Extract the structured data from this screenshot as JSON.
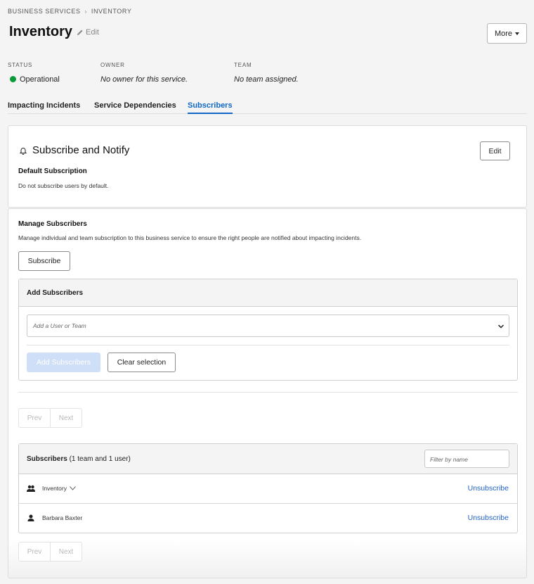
{
  "breadcrumb": [
    "BUSINESS SERVICES",
    "INVENTORY"
  ],
  "header": {
    "title": "Inventory",
    "edit_label": "Edit",
    "more_label": "More"
  },
  "meta": {
    "status": {
      "label": "STATUS",
      "value": "Operational",
      "color": "#0a9a37"
    },
    "owner": {
      "label": "OWNER",
      "value": "No owner for this service."
    },
    "team": {
      "label": "TEAM",
      "value": "No team assigned."
    }
  },
  "tabs": [
    {
      "label": "Impacting Incidents",
      "active": false
    },
    {
      "label": "Service Dependencies",
      "active": false
    },
    {
      "label": "Subscribers",
      "active": true
    }
  ],
  "notify_card": {
    "icon": "bell-icon",
    "title": "Subscribe and Notify",
    "edit_label": "Edit",
    "default_heading": "Default Subscription",
    "default_text": "Do not subscribe users by default."
  },
  "manage": {
    "heading": "Manage Subscribers",
    "description": "Manage individual and team subscription to this business service to ensure the right people are notified about impacting incidents.",
    "subscribe_label": "Subscribe",
    "add_panel": {
      "heading": "Add Subscribers",
      "select_placeholder": "Add a User or Team",
      "add_button": "Add Subscribers",
      "clear_button": "Clear selection"
    },
    "pager": {
      "prev": "Prev",
      "next": "Next"
    },
    "table": {
      "heading": "Subscribers",
      "summary": "(1 team and 1 user)",
      "filter_placeholder": "Filter by name",
      "rows": [
        {
          "type": "team",
          "icon": "team-icon",
          "name": "Inventory",
          "expandable": true,
          "action": "Unsubscribe"
        },
        {
          "type": "user",
          "icon": "user-icon",
          "name": "Barbara Baxter",
          "expandable": false,
          "action": "Unsubscribe"
        }
      ]
    }
  },
  "colors": {
    "accent": "#1067c5",
    "link": "#1f62c4",
    "disabled_button": "#cfdff7"
  }
}
